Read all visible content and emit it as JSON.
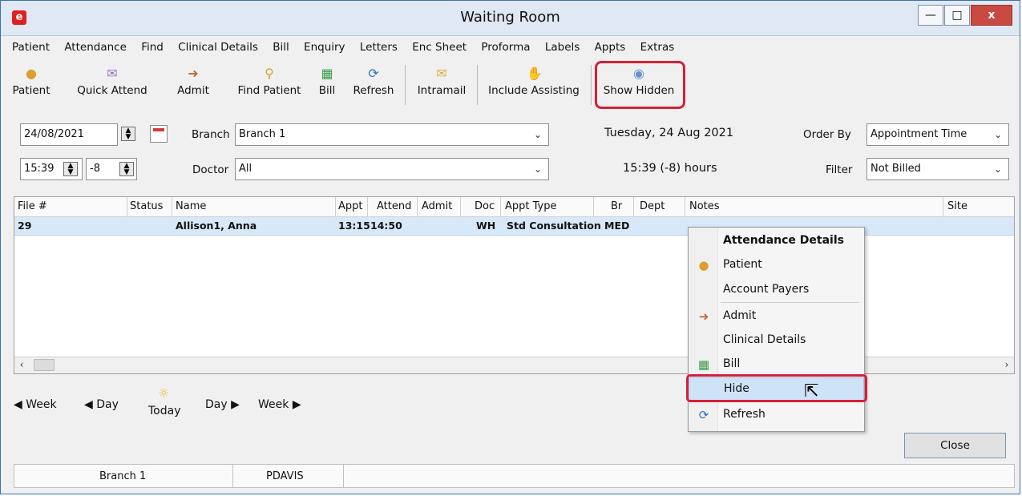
{
  "window": {
    "title": "Waiting Room",
    "min_icon": "minimize-icon",
    "max_icon": "maximize-icon",
    "close_glyph": "x"
  },
  "menu": [
    "Patient",
    "Attendance",
    "Find",
    "Clinical Details",
    "Bill",
    "Enquiry",
    "Letters",
    "Enc Sheet",
    "Proforma",
    "Labels",
    "Appts",
    "Extras"
  ],
  "toolbar": {
    "patient": "Patient",
    "quick_attend": "Quick Attend",
    "admit": "Admit",
    "find_patient": "Find Patient",
    "bill": "Bill",
    "refresh": "Refresh",
    "intramail": "Intramail",
    "include_assisting": "Include Assisting",
    "show_hidden": "Show Hidden"
  },
  "filters": {
    "date": "24/08/2021",
    "time": "15:39",
    "offset": "-8",
    "branch_label": "Branch",
    "branch_value": "Branch 1",
    "doctor_label": "Doctor",
    "doctor_value": "All",
    "day_text": "Tuesday, 24 Aug 2021",
    "time_text": "15:39 (-8)  hours",
    "order_by_label": "Order By",
    "order_by_value": "Appointment Time",
    "filter_label": "Filter",
    "filter_value": "Not Billed"
  },
  "grid": {
    "columns": [
      "File #",
      "Status",
      "Name",
      "Appt",
      "Attend",
      "Admit",
      "Doc",
      "Appt Type",
      "Br",
      "Dept",
      "Notes",
      "Site"
    ],
    "rows": [
      {
        "file": "29",
        "status": "",
        "name": "Allison1, Anna",
        "appt": "13:15",
        "attend": "14:50",
        "admit": "",
        "doc": "WH",
        "appt_type": "Std Consultation",
        "br": "MED",
        "dept": "",
        "notes": "",
        "site": ""
      }
    ]
  },
  "nav": {
    "week_back": "Week",
    "day_back": "Day",
    "today": "Today",
    "day_forward": "Day",
    "week_forward": "Week"
  },
  "close_label": "Close",
  "status": {
    "branch": "Branch 1",
    "user": "PDAVIS"
  },
  "context_menu": {
    "header": "Attendance Details",
    "patient": "Patient",
    "account_payers": "Account Payers",
    "admit": "Admit",
    "clinical_details": "Clinical Details",
    "bill": "Bill",
    "hide": "Hide",
    "refresh": "Refresh"
  },
  "colors": {
    "highlight": "#d4203a",
    "selected_row": "#d7e8f8"
  }
}
